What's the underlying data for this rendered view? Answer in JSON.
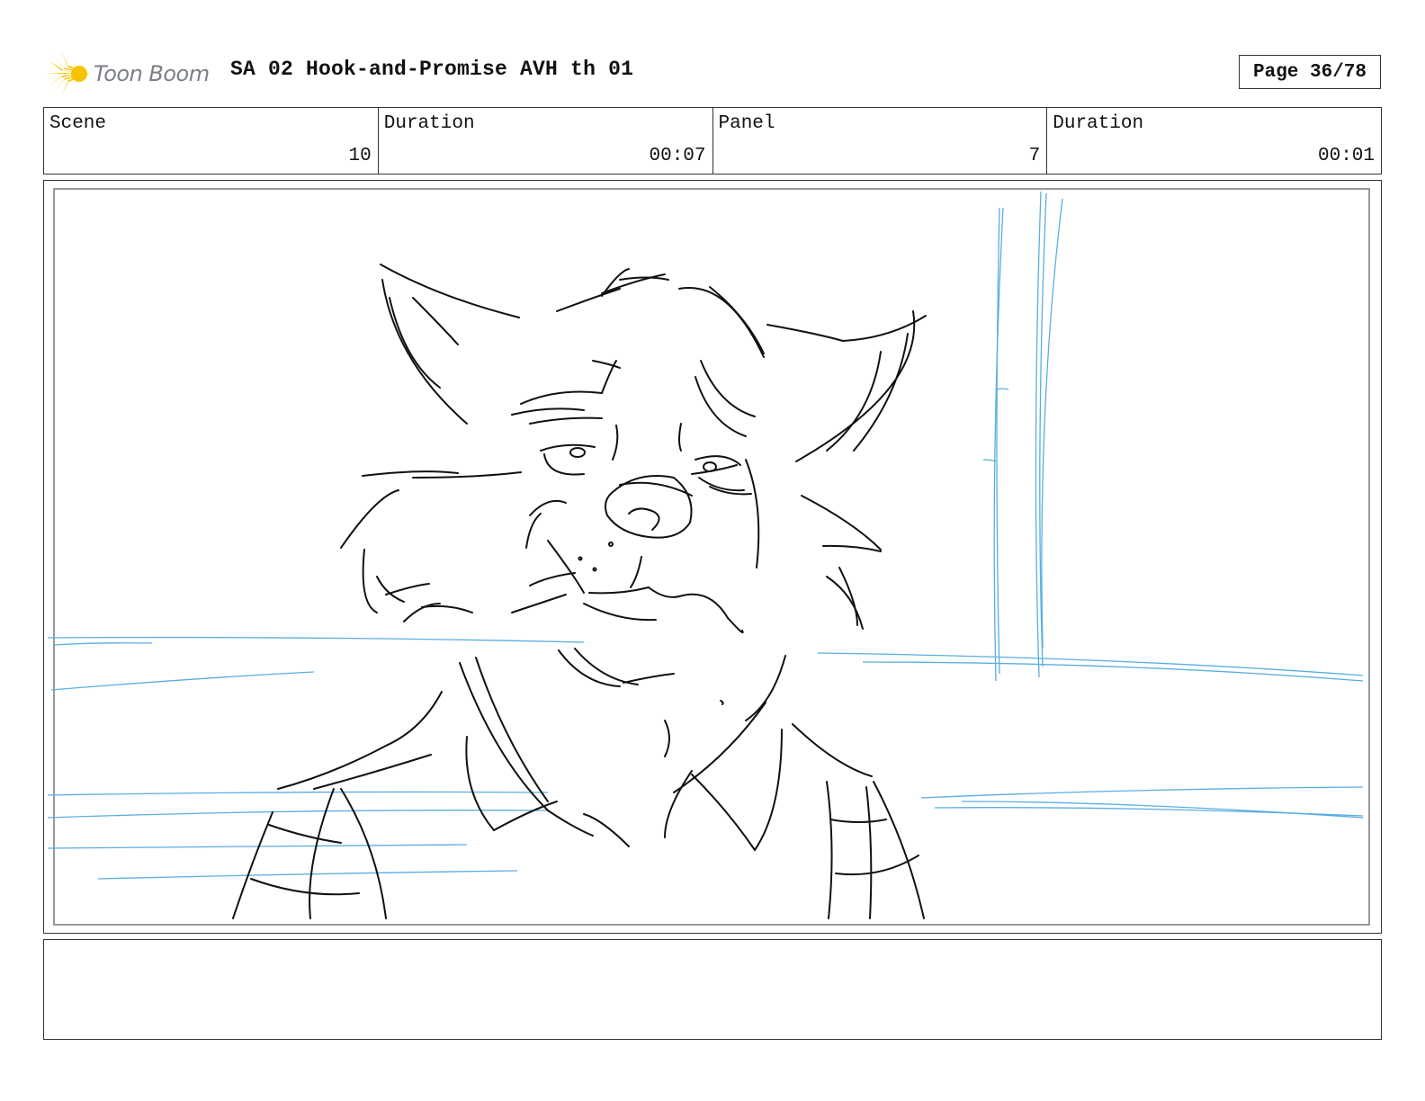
{
  "header": {
    "logo_text": "Toon Boom",
    "logo_color": "#f5c400",
    "title": "SA 02 Hook-and-Promise AVH th 01",
    "page_label": "Page 36/78"
  },
  "info": {
    "scene_label": "Scene",
    "scene_value": "10",
    "scene_duration_label": "Duration",
    "scene_duration_value": "00:07",
    "panel_label": "Panel",
    "panel_value": "7",
    "panel_duration_label": "Duration",
    "panel_duration_value": "00:01"
  },
  "panel": {
    "sketch_ink_color": "#111111",
    "guide_line_color": "#5aaee0"
  },
  "notes": {
    "text": ""
  }
}
